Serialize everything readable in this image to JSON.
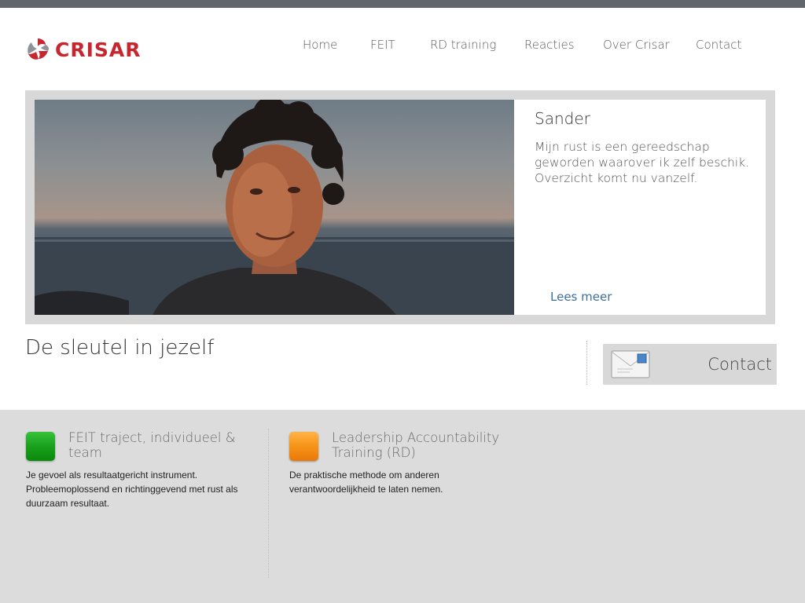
{
  "brand": {
    "name": "CRISAR",
    "color": "#c6262e",
    "logo_icon": "crisar-swirl-logo"
  },
  "nav": {
    "items": [
      {
        "label": "Home"
      },
      {
        "label": "FEIT"
      },
      {
        "label": "RD training"
      },
      {
        "label": "Reacties"
      },
      {
        "label": "Over Crisar"
      },
      {
        "label": "Contact"
      }
    ]
  },
  "hero": {
    "name": "Sander",
    "quote": "Mijn rust is een gereedschap geworden waarover ik zelf beschik. Overzicht komt nu vanzelf.",
    "more_link": "Lees meer"
  },
  "tagline": "De sleutel in jezelf",
  "contact": {
    "label": "Contact",
    "icon": "envelope-icon"
  },
  "features": [
    {
      "title": "FEIT traject, individueel & team",
      "text": "Je gevoel als resultaatgericht instrument. Probleemoplossend en richtinggevend met rust als duurzaam resultaat.",
      "icon_color": "#19a11b"
    },
    {
      "title": "Leadership Accountability Training (RD)",
      "text": "De praktische methode om anderen verantwoordelijkheid te laten nemen.",
      "icon_color": "#f79317"
    }
  ]
}
